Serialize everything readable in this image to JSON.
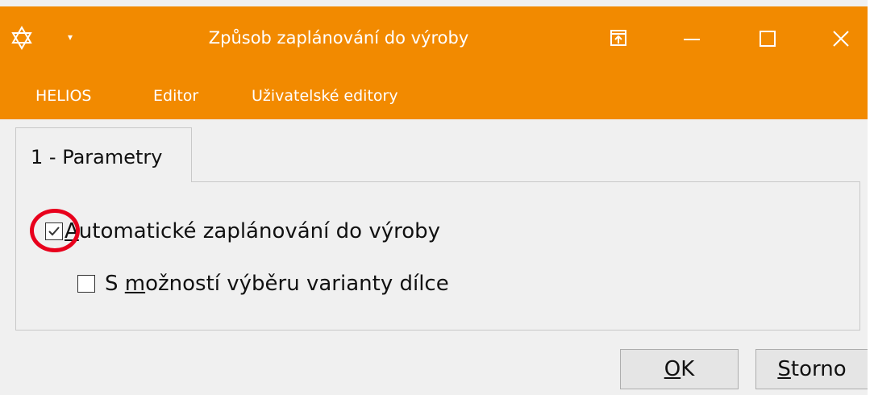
{
  "window": {
    "title": "Způsob zaplánování do výroby",
    "accent_color": "#f28a00"
  },
  "titlebar": {
    "app_icon": "star-of-david-icon",
    "quick_access_icon": "dropdown-arrow-icon",
    "pin_icon": "pin-window-icon",
    "minimize_icon": "minimize-icon",
    "maximize_icon": "maximize-icon",
    "close_icon": "close-icon"
  },
  "menu": {
    "items": [
      {
        "label": "HELIOS"
      },
      {
        "label": "Editor"
      },
      {
        "label": "Uživatelské editory"
      }
    ]
  },
  "tabs": [
    {
      "label": "1 - Parametry",
      "active": true
    }
  ],
  "options": {
    "auto_plan": {
      "label_mnemonic": "A",
      "label_rest": "utomatické zaplánování do výroby",
      "checked": true,
      "highlight_color": "#e8001c"
    },
    "variant_selection": {
      "label_pre": "S ",
      "label_mnemonic": "m",
      "label_rest": "ožností výběru varianty dílce",
      "checked": false
    }
  },
  "buttons": {
    "ok_mnemonic": "O",
    "ok_rest": "K",
    "cancel_mnemonic": "S",
    "cancel_rest": "torno"
  }
}
